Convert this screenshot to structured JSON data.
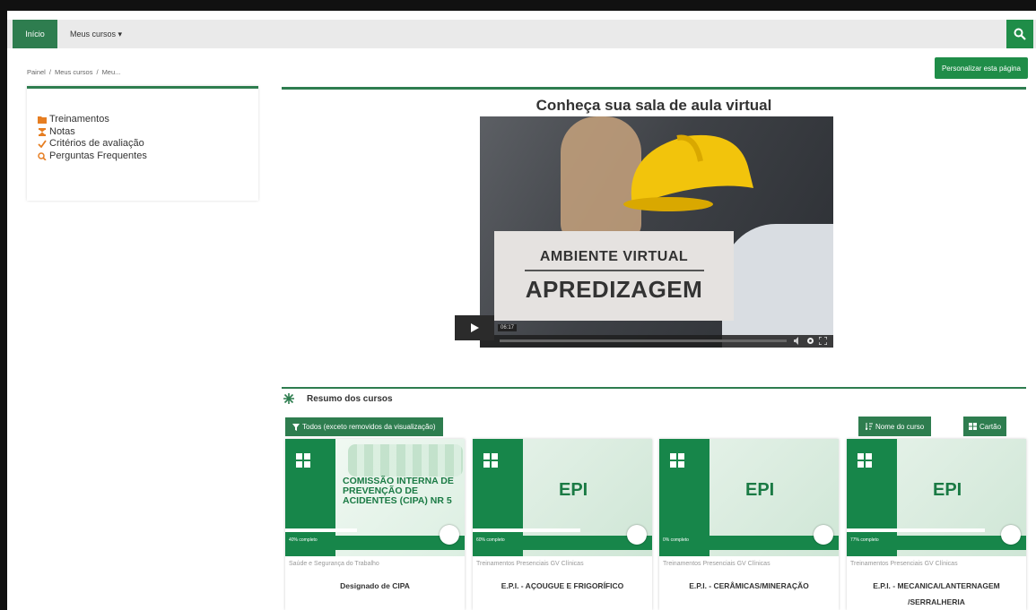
{
  "navbar": {
    "home_label": "Início",
    "mycourses_label": "Meus cursos ▾"
  },
  "breadcrumb": [
    "Painel",
    "/",
    "Meus cursos",
    "/",
    "Meu..."
  ],
  "customize_button": "Personalizar esta página",
  "sidebar": {
    "items": [
      {
        "label": "Treinamentos",
        "icon": "folder-icon"
      },
      {
        "label": "Notas",
        "icon": "hourglass-icon"
      },
      {
        "label": "Critérios de avaliação",
        "icon": "check-icon"
      },
      {
        "label": "Perguntas Frequentes",
        "icon": "search-icon"
      }
    ]
  },
  "video": {
    "title": "Conheça sua sala de aula virtual",
    "overlay_line1": "AMBIENTE VIRTUAL",
    "overlay_line2": "APREDIZAGEM",
    "time": "06:17"
  },
  "overview": {
    "title": "Resumo dos cursos",
    "filter_label": "Todos (exceto removidos da visualização)",
    "sort_label": "Nome do curso",
    "view_label": "Cartão"
  },
  "cards": [
    {
      "category": "Saúde e Segurança do Trabalho",
      "name": "Designado de CIPA",
      "percent": "40% completo",
      "heading": "COMISSÃO INTERNA DE PREVENÇÃO DE ACIDENTES (CIPA) NR 5",
      "progress": 0.4
    },
    {
      "category": "Treinamentos Presenciais GV Clínicas",
      "name": "E.P.I. - AÇOUGUE E FRIGORÍFICO",
      "percent": "60% completo",
      "heading": "EPI",
      "progress": 0.6
    },
    {
      "category": "Treinamentos Presenciais GV Clínicas",
      "name": "E.P.I. - CERÂMICAS/MINERAÇÃO",
      "percent": "0% completo",
      "heading": "EPI",
      "progress": 0.0
    },
    {
      "category": "Treinamentos Presenciais GV Clínicas",
      "name": "E.P.I. - MECANICA/LANTERNAGEM /SERRALHERIA",
      "percent": "77% completo",
      "heading": "EPI",
      "progress": 0.77
    }
  ],
  "colors": {
    "brand_green": "#2e7d4f",
    "accent_green": "#1f8d48",
    "orange": "#e67e22"
  }
}
